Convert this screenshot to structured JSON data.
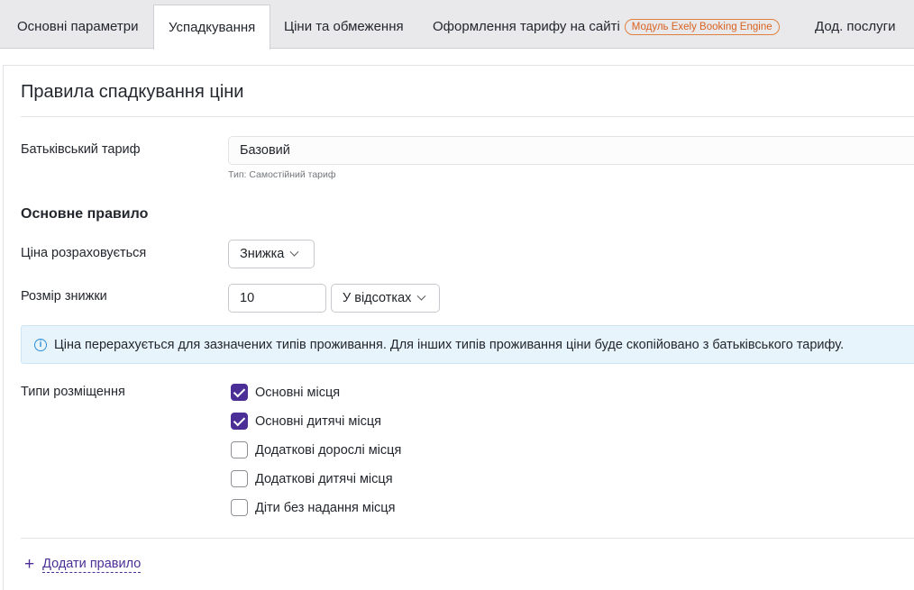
{
  "tabs": [
    {
      "label": "Основні параметри"
    },
    {
      "label": "Успадкування"
    },
    {
      "label": "Ціни та обмеження"
    },
    {
      "label": "Оформлення тарифу на сайті",
      "badge": "Модуль Exely Booking Engine"
    },
    {
      "label": "Дод. послуги"
    }
  ],
  "page_title": "Правила спадкування ціни",
  "parent_tariff": {
    "label": "Батьківський тариф",
    "value": "Базовий",
    "hint": "Тип: Самостійний тариф"
  },
  "main_rule": {
    "title": "Основне правило",
    "price_label": "Ціна розраховується",
    "price_value": "Знижка",
    "discount_label": "Розмір знижки",
    "discount_value": "10",
    "discount_unit": "У відсотках"
  },
  "info_message": "Ціна перерахується для зазначених типів проживання. Для інших типів проживання ціни буде скопійовано з батьківського тарифу.",
  "placement": {
    "label": "Типи розміщення",
    "options": [
      {
        "label": "Основні місця",
        "checked": true
      },
      {
        "label": "Основні дитячі місця",
        "checked": true
      },
      {
        "label": "Додаткові дорослі місця",
        "checked": false
      },
      {
        "label": "Додаткові дитячі місця",
        "checked": false
      },
      {
        "label": "Діти без надання місця",
        "checked": false
      }
    ]
  },
  "add_rule": "Додати правило",
  "colors": {
    "accent": "#4b2e96",
    "badge": "#d9621f",
    "info_bg": "#e8f4fb"
  }
}
